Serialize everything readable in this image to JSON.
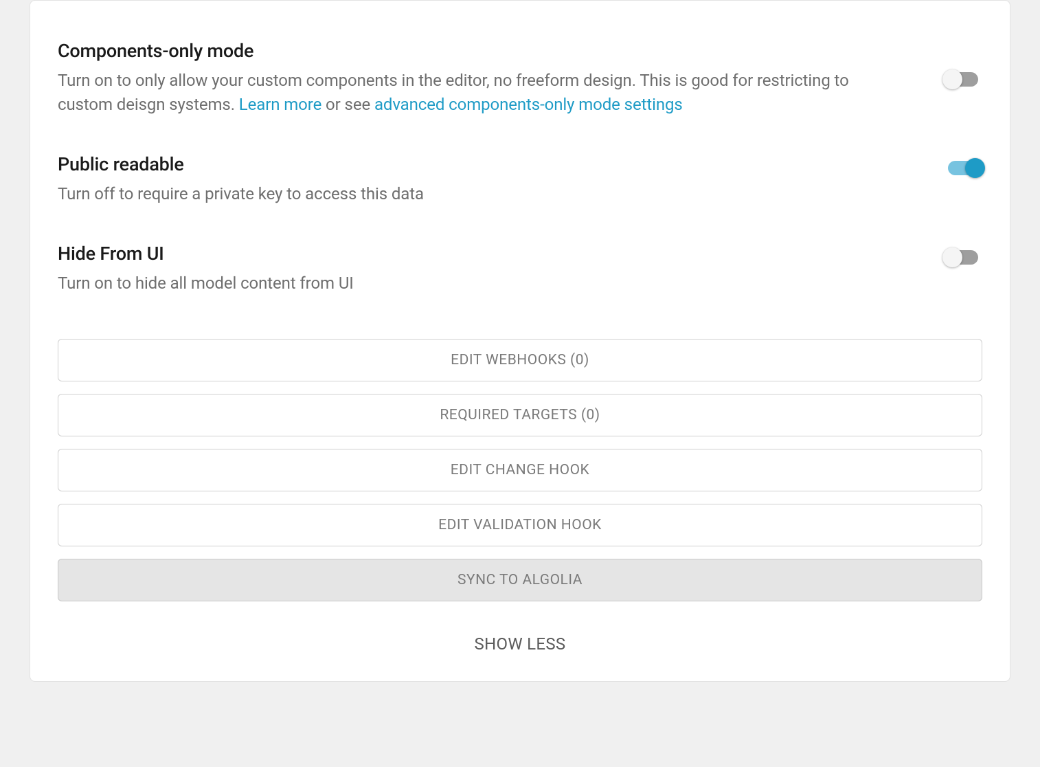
{
  "settings": {
    "componentsOnly": {
      "title": "Components-only mode",
      "descPart1": "Turn on to only allow your custom components in the editor, no freeform design. This is good for restricting to custom deisgn systems. ",
      "learnMore": "Learn more",
      "orSee": " or see ",
      "advancedLink": "advanced components-only mode settings",
      "enabled": false
    },
    "publicReadable": {
      "title": "Public readable",
      "desc": "Turn off to require a private key to access this data",
      "enabled": true
    },
    "hideFromUI": {
      "title": "Hide From UI",
      "desc": "Turn on to hide all model content from UI",
      "enabled": false
    }
  },
  "buttons": {
    "editWebhooks": "EDIT WEBHOOKS (0)",
    "requiredTargets": "REQUIRED TARGETS (0)",
    "editChangeHook": "EDIT CHANGE HOOK",
    "editValidationHook": "EDIT VALIDATION HOOK",
    "syncToAlgolia": "SYNC TO ALGOLIA"
  },
  "showLess": "SHOW LESS"
}
